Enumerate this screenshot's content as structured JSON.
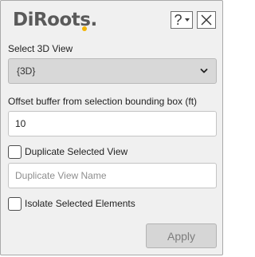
{
  "app": {
    "logo_text": "DiRoots.",
    "help_symbol": "?"
  },
  "view_select": {
    "label": "Select 3D View",
    "value": "{3D}"
  },
  "offset": {
    "label": "Offset buffer from selection bounding box (ft)",
    "value": "10"
  },
  "duplicate": {
    "label": "Duplicate Selected View",
    "checked": false,
    "placeholder": "Duplicate View Name"
  },
  "isolate": {
    "label": "Isolate Selected Elements",
    "checked": false
  },
  "actions": {
    "apply_label": "Apply",
    "apply_enabled": false
  },
  "icons": {
    "help": "help-icon",
    "caret": "caret-down-icon",
    "close": "close-icon",
    "chevron": "chevron-down-icon"
  },
  "colors": {
    "logo_text": "#5a5a5a",
    "logo_accent": "#f4b400",
    "panel_bg": "#f0f0f0",
    "dropdown_bg": "#d8d8d8",
    "disabled_text": "#7d7d7d"
  }
}
